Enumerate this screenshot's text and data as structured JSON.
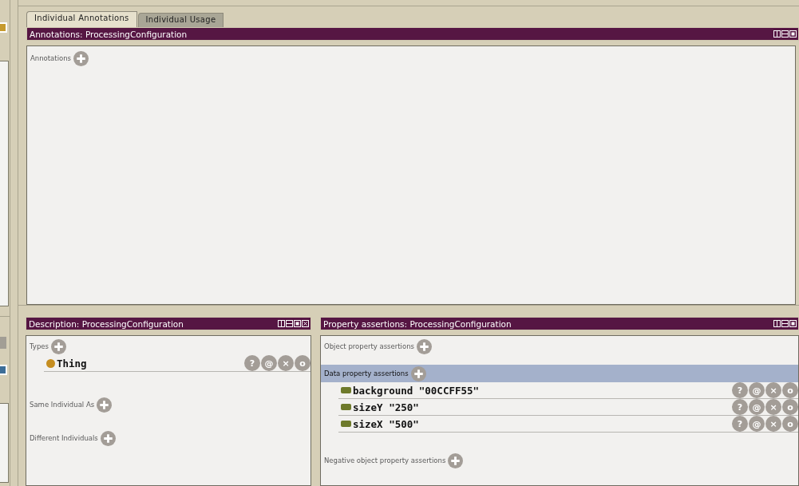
{
  "tabs": [
    {
      "label": "Individual Annotations",
      "selected": true
    },
    {
      "label": "Individual Usage",
      "selected": false
    }
  ],
  "annotations_panel": {
    "title": "Annotations: ProcessingConfiguration",
    "sections": [
      {
        "label": "Annotations",
        "highlighted": false
      }
    ]
  },
  "description_panel": {
    "title": "Description: ProcessingConfiguration",
    "sections": [
      {
        "label": "Types",
        "highlighted": false,
        "items": [
          {
            "kind": "class",
            "text": "Thing",
            "buttons": [
              "?",
              "@",
              "×",
              "o"
            ]
          }
        ]
      },
      {
        "label": "Same Individual As",
        "highlighted": false
      },
      {
        "label": "Different Individuals",
        "highlighted": false
      }
    ]
  },
  "property_panel": {
    "title": "Property assertions: ProcessingConfiguration",
    "sections": [
      {
        "label": "Object property assertions",
        "highlighted": false
      },
      {
        "label": "Data property assertions",
        "highlighted": true,
        "items": [
          {
            "kind": "data",
            "text": "background \"00CCFF55\"",
            "buttons": [
              "?",
              "@",
              "×",
              "o"
            ]
          },
          {
            "kind": "data",
            "text": "sizeY \"250\"",
            "buttons": [
              "?",
              "@",
              "×",
              "o"
            ]
          },
          {
            "kind": "data",
            "text": "sizeX \"500\"",
            "buttons": [
              "?",
              "@",
              "×",
              "o"
            ]
          }
        ]
      },
      {
        "label": "Negative object property assertions",
        "highlighted": false
      }
    ]
  }
}
